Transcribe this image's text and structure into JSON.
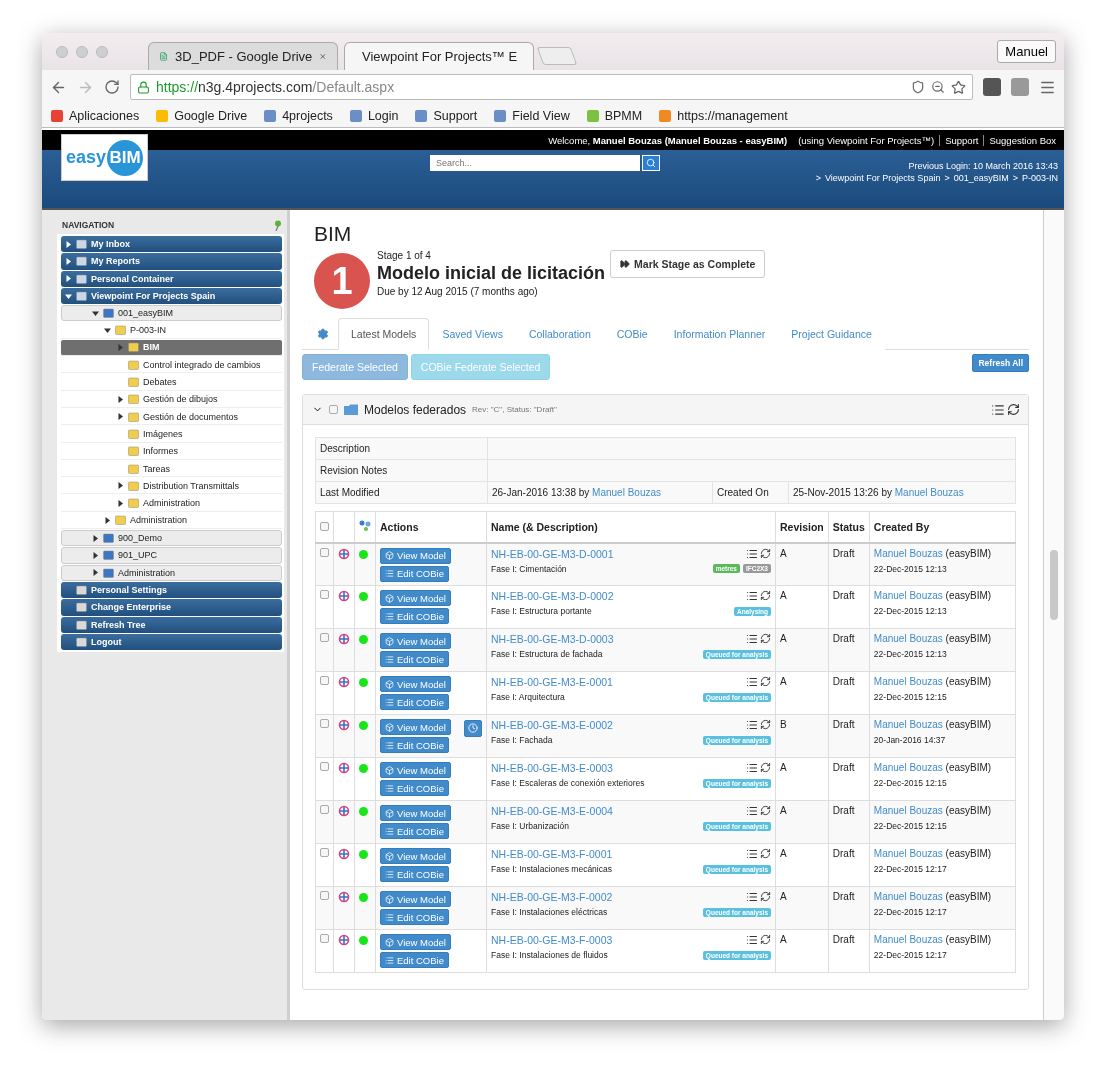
{
  "browser": {
    "tabs": [
      {
        "title": "3D_PDF - Google Drive",
        "selected": false
      },
      {
        "title": "Viewpoint For Projects™ E",
        "selected": true
      }
    ],
    "profile": "Manuel",
    "url": {
      "scheme": "https://",
      "host": "n3g.4projects.com",
      "path": "/Default.aspx"
    },
    "bookmarks": [
      "Aplicaciones",
      "Google Drive",
      "4projects",
      "Login",
      "Support",
      "Field View",
      "BPMM",
      "https://management"
    ]
  },
  "header": {
    "welcome": "Welcome, **Manuel Bouzas (Manuel Bouzas - easyBIM)**",
    "using": "(using Viewpoint For Projects™)",
    "links": [
      "Support",
      "Suggestion Box"
    ],
    "logo": {
      "word": "easy",
      "badge": "BIM"
    },
    "search": {
      "placeholder": "Search..."
    },
    "previous_login": "Previous Login:  10 March 2016 13:43",
    "breadcrumb_separator": ">",
    "breadcrumb": [
      "Viewpoint For Projects Spain",
      "001_easyBIM",
      "P-003-IN"
    ]
  },
  "sidebar": {
    "title": "NAVIGATION",
    "tree": [
      {
        "label": "My Inbox",
        "kind": "section",
        "expanded": false,
        "selected": false
      },
      {
        "label": "My Reports",
        "kind": "section",
        "expanded": false,
        "selected": false
      },
      {
        "label": "Personal Container",
        "kind": "section",
        "expanded": false,
        "selected": false
      },
      {
        "label": "Viewpoint For Projects Spain",
        "kind": "section",
        "expanded": true,
        "selected": false,
        "children": [
          {
            "label": "001_easyBIM",
            "kind": "group",
            "expanded": true,
            "selected": false,
            "children": [
              {
                "label": "P-003-IN",
                "kind": "node",
                "expanded": true,
                "selected": false,
                "children": [
                  {
                    "label": "BIM",
                    "kind": "node",
                    "expanded": false,
                    "selected": true
                  },
                  {
                    "label": "Control integrado de cambios",
                    "kind": "leaf",
                    "selected": false
                  },
                  {
                    "label": "Debates",
                    "kind": "leaf",
                    "selected": false
                  },
                  {
                    "label": "Gestión de dibujos",
                    "kind": "node",
                    "expanded": false,
                    "selected": false
                  },
                  {
                    "label": "Gestión de documentos",
                    "kind": "node",
                    "expanded": false,
                    "selected": false
                  },
                  {
                    "label": "Imágenes",
                    "kind": "leaf",
                    "selected": false
                  },
                  {
                    "label": "Informes",
                    "kind": "leaf",
                    "selected": false
                  },
                  {
                    "label": "Tareas",
                    "kind": "leaf",
                    "selected": false
                  },
                  {
                    "label": "Distribution Transmittals",
                    "kind": "node",
                    "expanded": false,
                    "selected": false
                  },
                  {
                    "label": "Administration",
                    "kind": "node",
                    "expanded": false,
                    "selected": false
                  }
                ]
              },
              {
                "label": "Administration",
                "kind": "node",
                "expanded": false,
                "selected": false
              }
            ]
          },
          {
            "label": "900_Demo",
            "kind": "group",
            "expanded": false,
            "selected": false
          },
          {
            "label": "901_UPC",
            "kind": "group",
            "expanded": false,
            "selected": false
          },
          {
            "label": "Administration",
            "kind": "group",
            "expanded": false,
            "selected": false
          }
        ]
      },
      {
        "label": "Personal Settings",
        "kind": "action",
        "selected": false
      },
      {
        "label": "Change Enterprise",
        "kind": "action",
        "selected": false
      },
      {
        "label": "Refresh Tree",
        "kind": "action",
        "selected": false
      },
      {
        "label": "Logout",
        "kind": "action",
        "selected": false
      }
    ]
  },
  "main": {
    "title": "BIM",
    "stage": {
      "number": "1",
      "of": "Stage 1 of 4",
      "name": "Modelo inicial de licitación",
      "due": "Due by 12 Aug 2015 (7 months ago)",
      "complete_button": "Mark Stage as Complete"
    },
    "tabs": [
      {
        "label": "Latest Models",
        "selected": true
      },
      {
        "label": "Saved Views",
        "selected": false
      },
      {
        "label": "Collaboration",
        "selected": false
      },
      {
        "label": "COBie",
        "selected": false
      },
      {
        "label": "Information Planner",
        "selected": false
      },
      {
        "label": "Project Guidance",
        "selected": false
      }
    ],
    "actions": [
      {
        "label": "Federate Selected",
        "kind": "primary",
        "disabled": true
      },
      {
        "label": "COBie Federate Selected",
        "kind": "info",
        "disabled": true
      }
    ],
    "refresh": "Refresh All",
    "panel": {
      "title": "Modelos federados",
      "meta": "Rev: \"C\",  Status: \"Draft\"",
      "expanded": true,
      "checked": false,
      "info": {
        "description_label": "Description",
        "notes_label": "Revision Notes",
        "modified_label": "Last Modified",
        "modified": "26-Jan-2016 13:38 by",
        "modified_by": "Manuel Bouzas",
        "created_label": "Created On",
        "created": "25-Nov-2015 13:26 by",
        "created_by": "Manuel Bouzas"
      },
      "table": {
        "all_checked": false,
        "columns": [
          "Actions",
          "Name (& Description)",
          "Revision",
          "Status",
          "Created By"
        ],
        "rows": [
          {
            "checked": false,
            "color": "#19e619",
            "view": "View Model",
            "edit": "Edit COBie",
            "timer": false,
            "name": "NH-EB-00-GE-M3-D-0001",
            "description": "Fase I: Cimentación",
            "tags": [
              {
                "label": "metres",
                "color": "#5cb85c"
              },
              {
                "label": "IFC2X3",
                "color": "#999999"
              }
            ],
            "revision": "A",
            "status": "Draft",
            "author": "Manuel Bouzas",
            "org": "(easyBIM)",
            "date": "22-Dec-2015 12:13"
          },
          {
            "checked": false,
            "color": "#19e619",
            "view": "View Model",
            "edit": "Edit COBie",
            "timer": false,
            "name": "NH-EB-00-GE-M3-D-0002",
            "description": "Fase I: Estructura portante",
            "tags": [
              {
                "label": "Analysing",
                "color": "#5bc0de"
              }
            ],
            "revision": "A",
            "status": "Draft",
            "author": "Manuel Bouzas",
            "org": "(easyBIM)",
            "date": "22-Dec-2015 12:13"
          },
          {
            "checked": false,
            "color": "#19e619",
            "view": "View Model",
            "edit": "Edit COBie",
            "timer": false,
            "name": "NH-EB-00-GE-M3-D-0003",
            "description": "Fase I: Estructura de fachada",
            "tags": [
              {
                "label": "Queued for analysis",
                "color": "#5bc0de"
              }
            ],
            "revision": "A",
            "status": "Draft",
            "author": "Manuel Bouzas",
            "org": "(easyBIM)",
            "date": "22-Dec-2015 12:13"
          },
          {
            "checked": false,
            "color": "#19e619",
            "view": "View Model",
            "edit": "Edit COBie",
            "timer": false,
            "name": "NH-EB-00-GE-M3-E-0001",
            "description": "Fase I: Arquitectura",
            "tags": [
              {
                "label": "Queued for analysis",
                "color": "#5bc0de"
              }
            ],
            "revision": "A",
            "status": "Draft",
            "author": "Manuel Bouzas",
            "org": "(easyBIM)",
            "date": "22-Dec-2015 12:15"
          },
          {
            "checked": false,
            "color": "#19e619",
            "view": "View Model",
            "edit": "Edit COBie",
            "timer": true,
            "name": "NH-EB-00-GE-M3-E-0002",
            "description": "Fase I: Fachada",
            "tags": [
              {
                "label": "Queued for analysis",
                "color": "#5bc0de"
              }
            ],
            "revision": "B",
            "status": "Draft",
            "author": "Manuel Bouzas",
            "org": "(easyBIM)",
            "date": "20-Jan-2016 14:37"
          },
          {
            "checked": false,
            "color": "#19e619",
            "view": "View Model",
            "edit": "Edit COBie",
            "timer": false,
            "name": "NH-EB-00-GE-M3-E-0003",
            "description": "Fase I: Escaleras de conexión exteriores",
            "tags": [
              {
                "label": "Queued for analysis",
                "color": "#5bc0de"
              }
            ],
            "revision": "A",
            "status": "Draft",
            "author": "Manuel Bouzas",
            "org": "(easyBIM)",
            "date": "22-Dec-2015 12:15"
          },
          {
            "checked": false,
            "color": "#19e619",
            "view": "View Model",
            "edit": "Edit COBie",
            "timer": false,
            "name": "NH-EB-00-GE-M3-E-0004",
            "description": "Fase I: Urbanización",
            "tags": [
              {
                "label": "Queued for analysis",
                "color": "#5bc0de"
              }
            ],
            "revision": "A",
            "status": "Draft",
            "author": "Manuel Bouzas",
            "org": "(easyBIM)",
            "date": "22-Dec-2015 12:15"
          },
          {
            "checked": false,
            "color": "#19e619",
            "view": "View Model",
            "edit": "Edit COBie",
            "timer": false,
            "name": "NH-EB-00-GE-M3-F-0001",
            "description": "Fase I: Instalaciones mecánicas",
            "tags": [
              {
                "label": "Queued for analysis",
                "color": "#5bc0de"
              }
            ],
            "revision": "A",
            "status": "Draft",
            "author": "Manuel Bouzas",
            "org": "(easyBIM)",
            "date": "22-Dec-2015 12:17"
          },
          {
            "checked": false,
            "color": "#19e619",
            "view": "View Model",
            "edit": "Edit COBie",
            "timer": false,
            "name": "NH-EB-00-GE-M3-F-0002",
            "description": "Fase I: Instalaciones eléctricas",
            "tags": [
              {
                "label": "Queued for analysis",
                "color": "#5bc0de"
              }
            ],
            "revision": "A",
            "status": "Draft",
            "author": "Manuel Bouzas",
            "org": "(easyBIM)",
            "date": "22-Dec-2015 12:17"
          },
          {
            "checked": false,
            "color": "#19e619",
            "view": "View Model",
            "edit": "Edit COBie",
            "timer": false,
            "name": "NH-EB-00-GE-M3-F-0003",
            "description": "Fase I: Instalaciones de fluidos",
            "tags": [
              {
                "label": "Queued for analysis",
                "color": "#5bc0de"
              }
            ],
            "revision": "A",
            "status": "Draft",
            "author": "Manuel Bouzas",
            "org": "(easyBIM)",
            "date": "22-Dec-2015 12:17"
          }
        ]
      }
    }
  }
}
